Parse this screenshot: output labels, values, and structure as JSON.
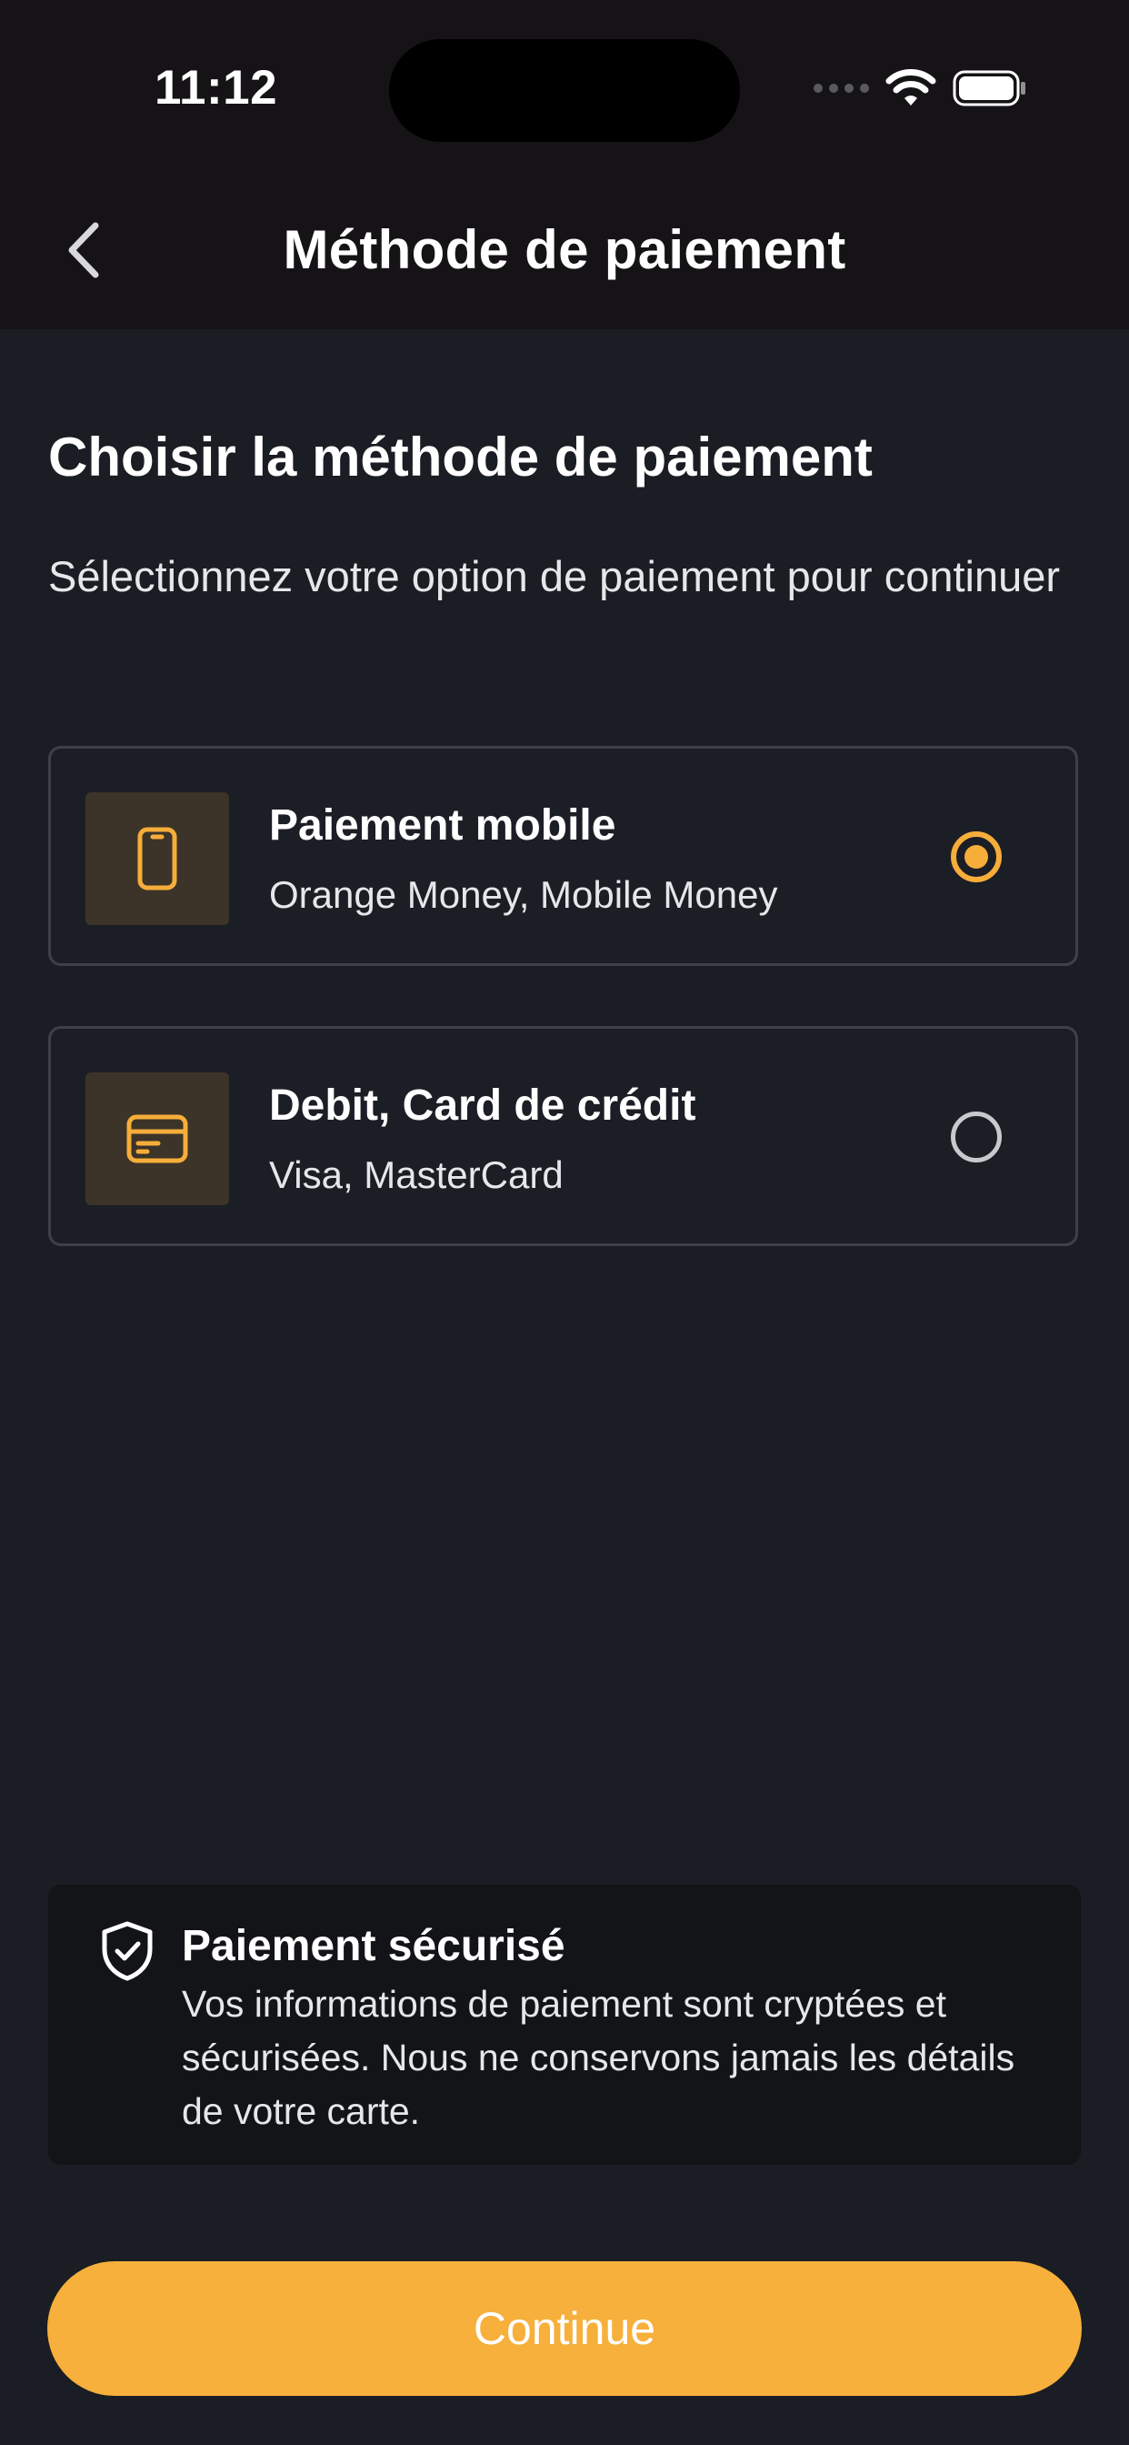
{
  "colors": {
    "accent": "#f6ad3a",
    "background": "#1a1d23",
    "header_background": "#151316",
    "card_border": "#3d4049",
    "icon_tile": "#3c3428"
  },
  "status_bar": {
    "time": "11:12",
    "icons": [
      "signal-dots-icon",
      "wifi-icon",
      "battery-icon"
    ]
  },
  "nav": {
    "back_icon": "chevron-left-icon",
    "title": "Méthode de paiement"
  },
  "main": {
    "title": "Choisir la méthode de paiement",
    "subtitle": "Sélectionnez votre option de paiement pour continuer",
    "options": [
      {
        "icon": "smartphone-icon",
        "title": "Paiement mobile",
        "subtitle": "Orange Money, Mobile Money",
        "selected": true
      },
      {
        "icon": "credit-card-icon",
        "title": "Debit, Card de crédit",
        "subtitle": "Visa, MasterCard",
        "selected": false
      }
    ]
  },
  "secure_notice": {
    "icon": "shield-check-icon",
    "title": "Paiement sécurisé",
    "text": "Vos informations de paiement sont cryptées et sécurisées. Nous ne conservons jamais les détails de votre carte."
  },
  "actions": {
    "continue_label": "Continue"
  }
}
